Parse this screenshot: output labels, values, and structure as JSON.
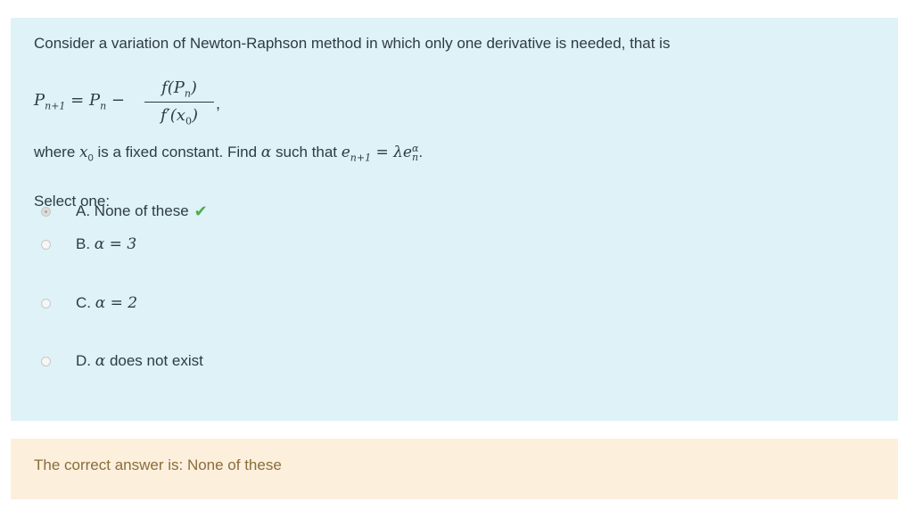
{
  "question": {
    "prompt": "Consider a variation of Newton-Raphson method in which only one derivative is needed, that is",
    "formula": {
      "lhs": "P",
      "lhs_sub": "n+1",
      "eq": " = ",
      "rhs": "P",
      "rhs_sub": "n",
      "minus": " − ",
      "numerator": "f(P",
      "numerator_sub": "n",
      "numerator_end": ")",
      "denominator": "f′(x",
      "denominator_sub": "0",
      "denominator_end": ")",
      "comma": ","
    },
    "where_prefix": "where ",
    "where_var": "x",
    "where_var_sub": "0",
    "where_mid": " is a fixed constant. Find ",
    "alpha": "α",
    "where_such": " such that ",
    "e_lhs": "e",
    "e_lhs_sub": "n+1",
    "e_eq": " = λe",
    "e_rhs_sup": "α",
    "e_rhs_sub": "n",
    "period": "."
  },
  "select_label": "Select one:",
  "options": [
    {
      "prefix": "A. ",
      "text": "None of these",
      "checked": true,
      "correct_icon": "check-icon"
    },
    {
      "prefix": "B. ",
      "text": "α = 3",
      "checked": false
    },
    {
      "prefix": "C. ",
      "text": "α = 2",
      "checked": false
    },
    {
      "prefix": "D. ",
      "text_alpha": "α",
      "text": " does not exist",
      "checked": false
    }
  ],
  "feedback": "The correct answer is: None of these",
  "colors": {
    "question_bg": "#def2f8",
    "feedback_bg": "#fcefdc",
    "feedback_text": "#8a6d3b",
    "check": "#4fae4f"
  }
}
